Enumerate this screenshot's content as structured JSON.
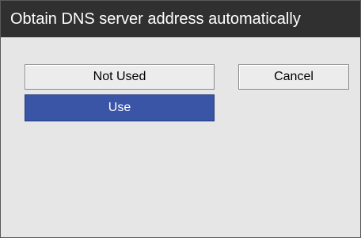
{
  "window": {
    "title": "Obtain DNS server address automatically"
  },
  "options": {
    "not_used_label": "Not Used",
    "use_label": "Use",
    "selected": "Use"
  },
  "actions": {
    "cancel_label": "Cancel"
  },
  "colors": {
    "title_bar_bg": "#303030",
    "content_bg": "#e6e6e6",
    "selected_bg": "#3a55a6"
  }
}
